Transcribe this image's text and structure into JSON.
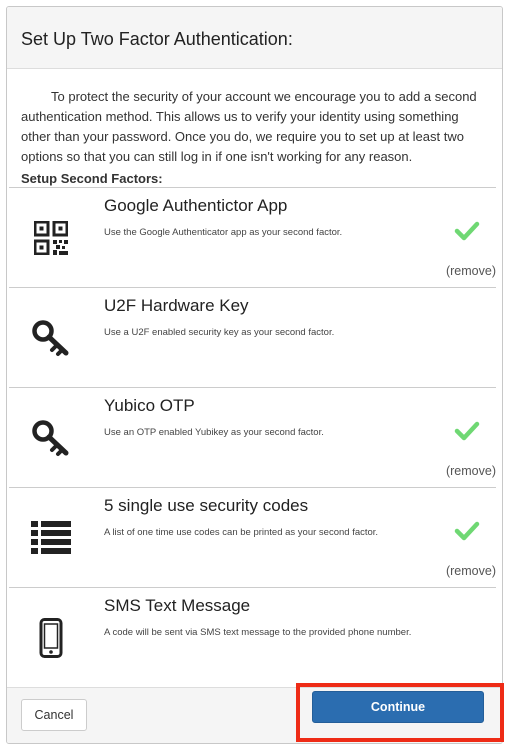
{
  "modal": {
    "title": "Set Up Two Factor Authentication:",
    "intro": "To protect the security of your account we encourage you to add a second authentication method. This allows us to verify your identity using something other than your password. Once you do, we require you to set up at least two options so that you can still log in if one isn't working for any reason.",
    "section_label": "Setup Second Factors:"
  },
  "factors": [
    {
      "name": "Google Authentictor App",
      "description": "Use the Google Authenticator app as your second factor.",
      "icon": "qr-code-icon",
      "enabled": true,
      "remove_label": "(remove)"
    },
    {
      "name": "U2F Hardware Key",
      "description": "Use a U2F enabled security key as your second factor.",
      "icon": "key-icon",
      "enabled": false
    },
    {
      "name": "Yubico OTP",
      "description": "Use an OTP enabled Yubikey as your second factor.",
      "icon": "key-icon",
      "enabled": true,
      "remove_label": "(remove)"
    },
    {
      "name": "5 single use security codes",
      "description": "A list of one time use codes can be printed as your second factor.",
      "icon": "list-icon",
      "enabled": true,
      "remove_label": "(remove)"
    },
    {
      "name": "SMS Text Message",
      "description": "A code will be sent via SMS text message to the provided phone number.",
      "icon": "mobile-phone-icon",
      "enabled": false
    }
  ],
  "footer": {
    "cancel_label": "Cancel",
    "continue_label": "Continue"
  },
  "colors": {
    "check": "#6fd873",
    "primary": "#2b6db0",
    "highlight": "#ee2b16"
  }
}
